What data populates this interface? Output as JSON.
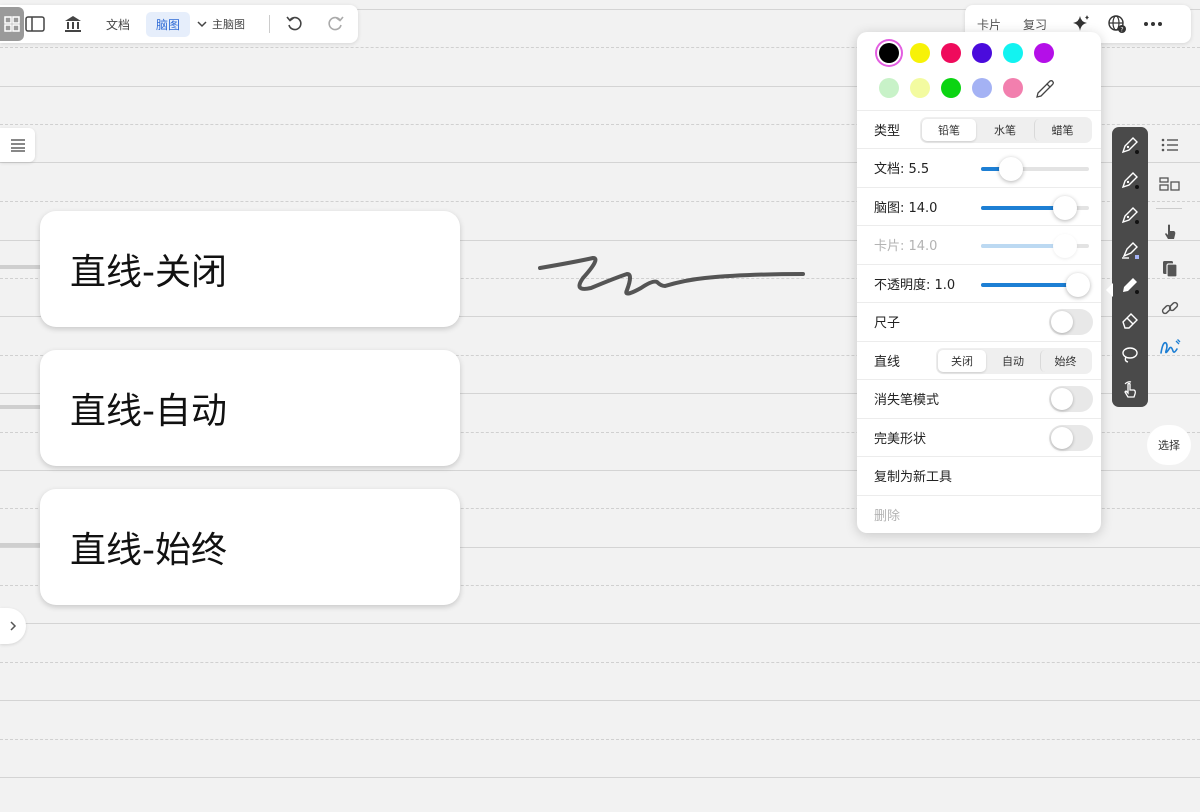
{
  "toolbar": {
    "doc_label": "文档",
    "mindmap_label": "脑图",
    "main_mindmap_label": "主脑图"
  },
  "toolbar_right": {
    "card_label": "卡片",
    "review_label": "复习"
  },
  "nodes": [
    {
      "text": "直线-关闭"
    },
    {
      "text": "直线-自动"
    },
    {
      "text": "直线-始终"
    }
  ],
  "pen_panel": {
    "colors_row1": [
      "#000000",
      "#f7f207",
      "#ef0b5c",
      "#4a0bdc",
      "#12f3f1",
      "#b40fe8"
    ],
    "colors_row2": [
      "#c8f2c8",
      "#f3fba0",
      "#0bd412",
      "#a4b2f4",
      "#f27fae"
    ],
    "selected_color": "#000000",
    "type_label": "类型",
    "type_options": [
      "铅笔",
      "水笔",
      "蜡笔"
    ],
    "type_selected": "铅笔",
    "doc_width_label": "文档: 5.5",
    "doc_width_fraction": 0.28,
    "mindmap_width_label": "脑图: 14.0",
    "mindmap_width_fraction": 0.78,
    "card_width_label": "卡片: 14.0",
    "card_width_fraction": 0.78,
    "opacity_label": "不透明度: 1.0",
    "opacity_fraction": 0.9,
    "ruler_label": "尺子",
    "ruler_on": false,
    "line_label": "直线",
    "line_options": [
      "关闭",
      "自动",
      "始终"
    ],
    "line_selected": "关闭",
    "vanish_label": "消失笔模式",
    "vanish_on": false,
    "perfect_shape_label": "完美形状",
    "perfect_shape_on": false,
    "duplicate_label": "复制为新工具",
    "delete_label": "删除"
  },
  "side_rail": {
    "select_label": "选择"
  },
  "colors": {
    "accent": "#1d7fd4",
    "palette_bg": "#4a4a4a"
  }
}
